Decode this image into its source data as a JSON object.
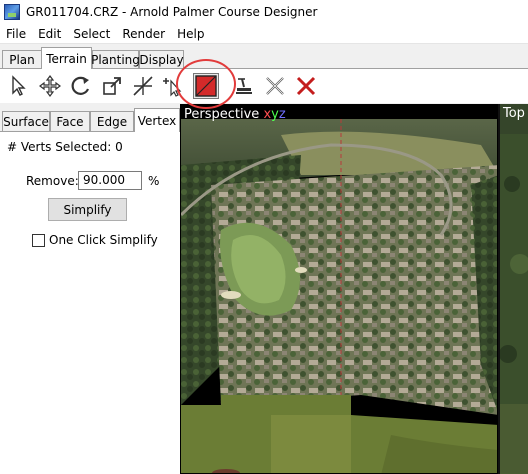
{
  "window": {
    "title": "GR011704.CRZ - Arnold Palmer Course Designer"
  },
  "menu": {
    "items": [
      "File",
      "Edit",
      "Select",
      "Render",
      "Help"
    ]
  },
  "main_tabs": [
    "Plan",
    "Terrain",
    "Planting",
    "Display"
  ],
  "active_main_tab": "Terrain",
  "toolbar": {
    "tools": [
      "select-arrow-icon",
      "move-arrows-icon",
      "rotate-icon",
      "scale-icon",
      "slice-icon",
      "add-vertex-icon",
      "texture-paint-icon",
      "stamp-icon",
      "delete-vertex-icon",
      "delete-icon"
    ],
    "selected_tool": "texture-paint-icon",
    "highlight_color": "#e23b3b"
  },
  "sub_tabs": [
    "Surface",
    "Face",
    "Edge",
    "Vertex"
  ],
  "active_sub_tab": "Vertex",
  "vertex_panel": {
    "verts_selected": "# Verts Selected: 0",
    "remove_label": "Remove:",
    "remove_value": "90.000",
    "remove_unit": "%",
    "simplify_button": "Simplify",
    "one_click_label": "One Click Simplify",
    "one_click_checked": false
  },
  "viewports": {
    "perspective": {
      "label": "Perspective",
      "axis_x": "x",
      "axis_y": "y",
      "axis_z": "z"
    },
    "top": {
      "label": "Top"
    }
  }
}
